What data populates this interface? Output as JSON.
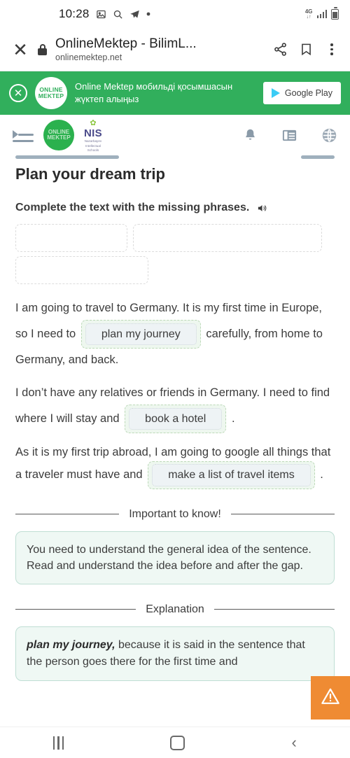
{
  "status_bar": {
    "time": "10:28",
    "icons": [
      "image-icon",
      "search-icon",
      "telegram-icon",
      "dot-icon"
    ],
    "network": "4G",
    "network_sub": "↓↑"
  },
  "browser": {
    "close_label": "✕",
    "lock_icon": "lock-icon",
    "title": "OnlineMektep - BilimL...",
    "url": "onlinemektep.net",
    "share_icon": "share-icon",
    "bookmark_icon": "bookmark-icon",
    "menu_icon": "overflow-menu-icon"
  },
  "promo": {
    "close_label": "✕",
    "logo_text": "ONLINE\nMEKTEP",
    "message": "Online Mektep мобильді қосымшасын жүктеп алыңыз",
    "store_button": "Google Play",
    "bg_color": "#31af5c"
  },
  "sitenav": {
    "menu_icon": "hamburger-menu-icon",
    "brand_logo_text": "ONLINE\nMEKTEP",
    "nis_title": "NIS",
    "nis_subtitle": "Nazarbayev\nIntellectual\nSchools",
    "bell_icon": "bell-icon",
    "list_icon": "list-icon",
    "globe_icon": "globe-icon"
  },
  "lesson": {
    "title": "Plan your dream trip",
    "instruction": "Complete the text with the missing phrases.",
    "audio_icon": "speaker-icon",
    "drop_zones": [
      "",
      "",
      ""
    ],
    "paragraphs": [
      {
        "before": "I am going to travel to Germany. It is my first time in Europe, so I need to",
        "answer": "plan my journey",
        "after": "carefully, from home to Germany, and back."
      },
      {
        "before": "I don’t have any relatives or friends in Germany. I need to find where I will stay and",
        "answer": "book a hotel",
        "after": "."
      },
      {
        "before": "As it is my first trip abroad, I am going to google all things that a traveler must have and",
        "answer": "make a list of travel items",
        "after": "."
      }
    ]
  },
  "important": {
    "label": "Important to know!",
    "body": "You need to understand the general idea of the sentence. Read and understand the idea before and after the gap."
  },
  "explanation": {
    "label": "Explanation",
    "highlight": "plan my journey,",
    "body": "because it is said in the sentence that the person goes there for the first time and"
  },
  "fab": {
    "icon": "warning-triangle-icon",
    "color": "#ef8b33"
  },
  "android_nav": {
    "recents": "recents-button",
    "home": "home-button",
    "back": "back-button"
  }
}
